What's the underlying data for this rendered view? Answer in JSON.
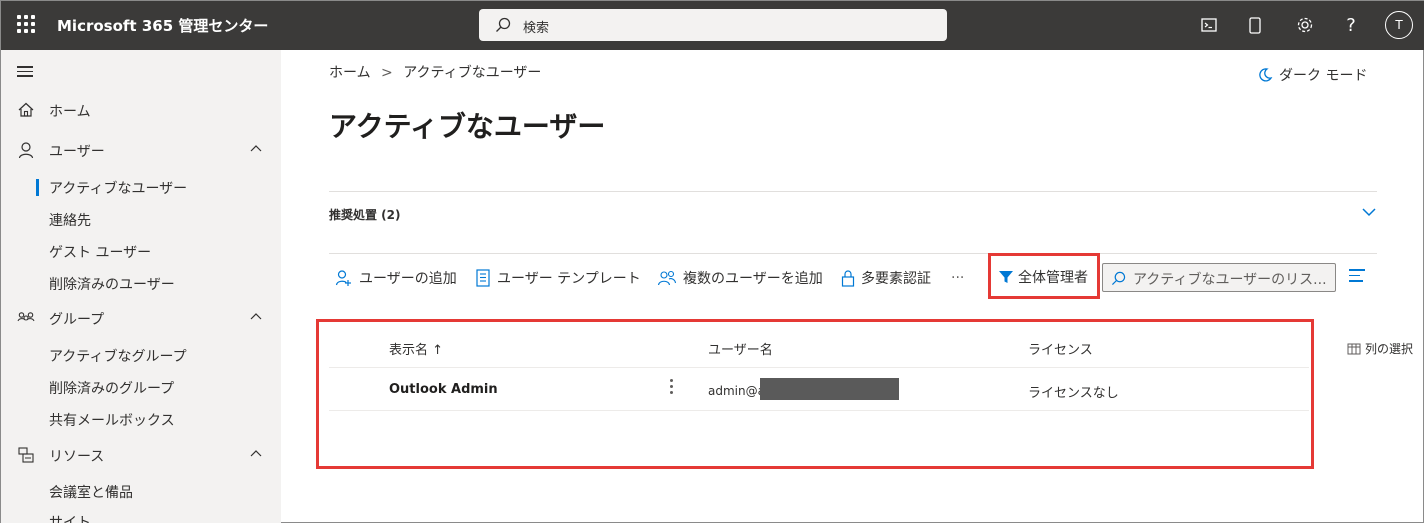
{
  "header": {
    "app_title": "Microsoft 365 管理センター",
    "search_placeholder": "検索",
    "avatar_initial": "T",
    "icons": [
      "waffle-icon",
      "terminal-icon",
      "phone-icon",
      "gear-icon",
      "help-icon"
    ]
  },
  "nav": {
    "items": [
      {
        "label": "ホーム",
        "icon": "home-icon"
      },
      {
        "label": "ユーザー",
        "icon": "person-icon",
        "expanded": true
      },
      {
        "label": "グループ",
        "icon": "group-icon",
        "expanded": true
      },
      {
        "label": "リソース",
        "icon": "resource-icon",
        "expanded": true
      }
    ],
    "users_sub": [
      "アクティブなユーザー",
      "連絡先",
      "ゲスト ユーザー",
      "削除済みのユーザー"
    ],
    "groups_sub": [
      "アクティブなグループ",
      "削除済みのグループ",
      "共有メールボックス"
    ],
    "resources_sub": [
      "会議室と備品",
      "サイト"
    ]
  },
  "breadcrumb": {
    "home": "ホーム",
    "separator": ">",
    "current": "アクティブなユーザー"
  },
  "dark_mode_label": "ダーク モード",
  "page_title": "アクティブなユーザー",
  "recommendations_label": "推奨処置 (2)",
  "commands": {
    "add_user": "ユーザーの追加",
    "user_template": "ユーザー テンプレート",
    "add_multiple": "複数のユーザーを追加",
    "mfa": "多要素認証",
    "more": "···",
    "filter": "全体管理者",
    "list_search_placeholder": "アクティブなユーザーのリス..."
  },
  "table": {
    "columns": [
      "表示名 ↑",
      "ユーザー名",
      "ライセンス"
    ],
    "column_select": "列の選択",
    "rows": [
      {
        "display_name": "Outlook Admin",
        "username": "admin@a",
        "license": "ライセンスなし"
      }
    ]
  },
  "colors": {
    "accent": "#0078d4",
    "topbar": "#3b3a39",
    "nav_bg": "#f3f2f1",
    "highlight": "#e53935"
  }
}
